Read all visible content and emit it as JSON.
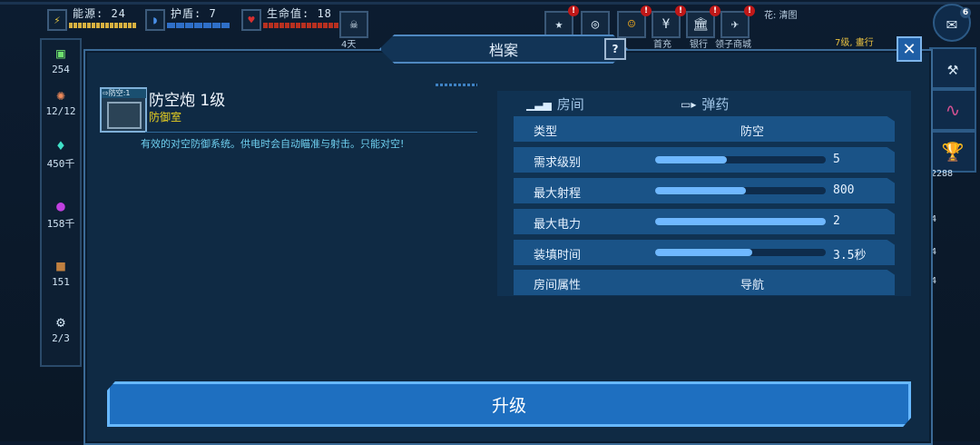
{
  "hud": {
    "energy_label": "能源: 24",
    "shield_label": "护盾: 7",
    "health_label": "生命值: 18",
    "day_label": "4天",
    "first_charge_label": "首充",
    "bank_label": "银行",
    "shop_label": "领子商城",
    "flower_label": "花: 清图",
    "level_label": "7级, 畫行",
    "chat_count": "6"
  },
  "sidebar": {
    "items": [
      {
        "value": "254",
        "icon": "cash-icon"
      },
      {
        "value": "12/12",
        "icon": "brain-icon"
      },
      {
        "value": "450千",
        "icon": "crystal-icon"
      },
      {
        "value": "158千",
        "icon": "planet-icon"
      },
      {
        "value": "151",
        "icon": "crate-icon"
      },
      {
        "value": "2/3",
        "icon": "drone-gear-icon"
      }
    ]
  },
  "right_side": {
    "chat_icon": "chat-bubble-icon",
    "tools_icon": "hammer-wrench-icon",
    "monitor_icon": "heartbeat-monitor-icon",
    "trophy_icon": "trophy-icon",
    "side_numbers": [
      "2288",
      "4",
      "4",
      "4"
    ]
  },
  "dialog": {
    "title": "档案",
    "help_label": "?",
    "close_label": "✕",
    "item": {
      "tag": "⇨防空:1",
      "name": "防空炮 1级",
      "category": "防御室",
      "description": "有效的对空防御系统。供电时会自动瞄准与射击。只能对空!"
    },
    "tabs": [
      {
        "label": "房间",
        "icon": "bar-chart-icon"
      },
      {
        "label": "弹药",
        "icon": "ammo-icon"
      }
    ],
    "stats": [
      {
        "label": "类型",
        "value": "防空",
        "kind": "text"
      },
      {
        "label": "需求级别",
        "value": "5",
        "kind": "bar",
        "fill": 0.42
      },
      {
        "label": "最大射程",
        "value": "800",
        "kind": "bar",
        "fill": 0.53
      },
      {
        "label": "最大电力",
        "value": "2",
        "kind": "bar",
        "fill": 1.0
      },
      {
        "label": "装填时间",
        "value": "3.5秒",
        "kind": "bar",
        "fill": 0.57
      },
      {
        "label": "房间属性",
        "value": "导航",
        "kind": "text"
      }
    ],
    "upgrade_label": "升级"
  },
  "colors": {
    "accent": "#1e6fc0",
    "bar_fill": "#6fb8ff",
    "category_yellow": "#e8d020",
    "description_cyan": "#6fd0f0"
  }
}
